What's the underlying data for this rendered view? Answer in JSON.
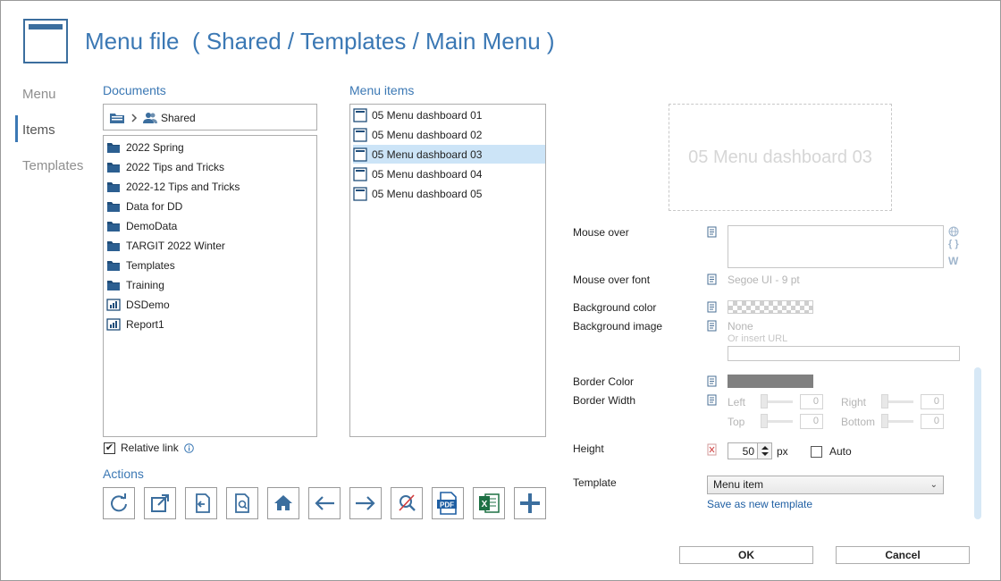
{
  "window": {
    "title": "Menu file",
    "path": "( Shared / Templates / Main Menu )"
  },
  "nav": {
    "items": [
      {
        "label": "Menu",
        "active": false
      },
      {
        "label": "Items",
        "active": true
      },
      {
        "label": "Templates",
        "active": false
      }
    ]
  },
  "documents": {
    "label": "Documents",
    "breadcrumb": "Shared",
    "items": [
      {
        "label": "2022 Spring",
        "icon": "folder-icon"
      },
      {
        "label": "2022 Tips and Tricks",
        "icon": "folder-icon"
      },
      {
        "label": "2022-12 Tips and Tricks",
        "icon": "folder-icon"
      },
      {
        "label": "Data for DD",
        "icon": "folder-icon"
      },
      {
        "label": "DemoData",
        "icon": "folder-icon"
      },
      {
        "label": "TARGIT 2022 Winter",
        "icon": "folder-icon"
      },
      {
        "label": "Templates",
        "icon": "folder-icon"
      },
      {
        "label": "Training",
        "icon": "folder-icon"
      },
      {
        "label": "DSDemo",
        "icon": "report-icon"
      },
      {
        "label": "Report1",
        "icon": "report-icon"
      }
    ],
    "relative_link_label": "Relative link",
    "relative_link_checked": true
  },
  "menu_items": {
    "label": "Menu items",
    "items": [
      {
        "label": "05 Menu dashboard 01",
        "selected": false
      },
      {
        "label": "05 Menu dashboard 02",
        "selected": false
      },
      {
        "label": "05 Menu dashboard 03",
        "selected": true
      },
      {
        "label": "05 Menu dashboard 04",
        "selected": false
      },
      {
        "label": "05 Menu dashboard 05",
        "selected": false
      }
    ]
  },
  "actions": {
    "label": "Actions",
    "buttons": [
      "refresh-icon",
      "open-external-icon",
      "import-icon",
      "search-document-icon",
      "home-icon",
      "arrow-left-icon",
      "arrow-right-icon",
      "clear-search-icon",
      "pdf-icon",
      "excel-icon",
      "add-icon"
    ],
    "pdf_text": "PDF",
    "excel_text": "X"
  },
  "preview": {
    "text": "05 Menu dashboard 03"
  },
  "properties": {
    "mouse_over": {
      "label": "Mouse over",
      "value": ""
    },
    "mouse_over_font": {
      "label": "Mouse over font",
      "value": "Segoe UI - 9 pt"
    },
    "background_color": {
      "label": "Background color"
    },
    "background_image": {
      "label": "Background image",
      "value": "None",
      "url_hint": "Or insert URL"
    },
    "border_color": {
      "label": "Border Color",
      "color": "#808080"
    },
    "border_width": {
      "label": "Border Width",
      "left": {
        "label": "Left",
        "value": "0"
      },
      "right": {
        "label": "Right",
        "value": "0"
      },
      "top": {
        "label": "Top",
        "value": "0"
      },
      "bottom": {
        "label": "Bottom",
        "value": "0"
      }
    },
    "height": {
      "label": "Height",
      "value": "50",
      "unit": "px",
      "auto_label": "Auto",
      "auto_checked": false
    },
    "template": {
      "label": "Template",
      "value": "Menu item",
      "save_link": "Save as new template"
    },
    "side_icons": {
      "globe": "globe-icon",
      "braces": "{ }",
      "w": "W"
    }
  },
  "footer": {
    "ok": "OK",
    "cancel": "Cancel"
  },
  "colors": {
    "accent": "#3b78b4",
    "selection": "#cce4f7",
    "excel_green": "#1d7044",
    "pdf_blue": "#1f5fa3"
  }
}
